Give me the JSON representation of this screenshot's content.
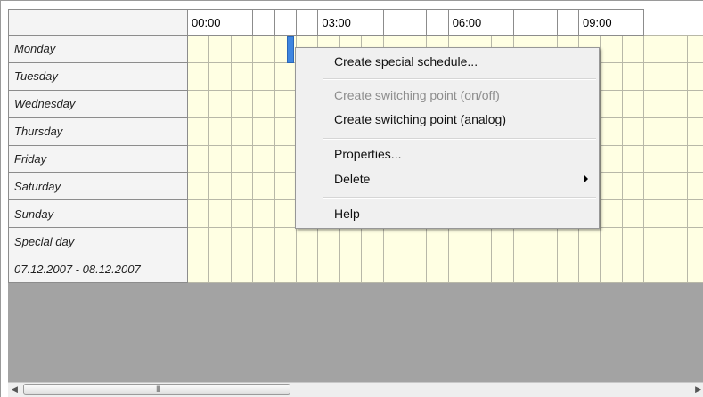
{
  "timeline": {
    "hour_labels": [
      "00:00",
      "03:00",
      "06:00",
      "09:00"
    ]
  },
  "days": [
    "Monday",
    "Tuesday",
    "Wednesday",
    "Thursday",
    "Friday",
    "Saturday",
    "Sunday",
    "Special day",
    "07.12.2007 - 08.12.2007"
  ],
  "context_menu": {
    "create_special_schedule": "Create special schedule...",
    "create_switching_onoff": "Create switching point (on/off)",
    "create_switching_analog": "Create switching point (analog)",
    "properties": "Properties...",
    "delete": "Delete",
    "help": "Help"
  },
  "scrollbar": {
    "grip": "III"
  },
  "colors": {
    "grid_cell_bg": "#ffffe3",
    "label_bg": "#f4f4f4",
    "empty_area": "#a3a3a3",
    "marker": "#3f86e0",
    "disabled_text": "#8d8d8d"
  }
}
